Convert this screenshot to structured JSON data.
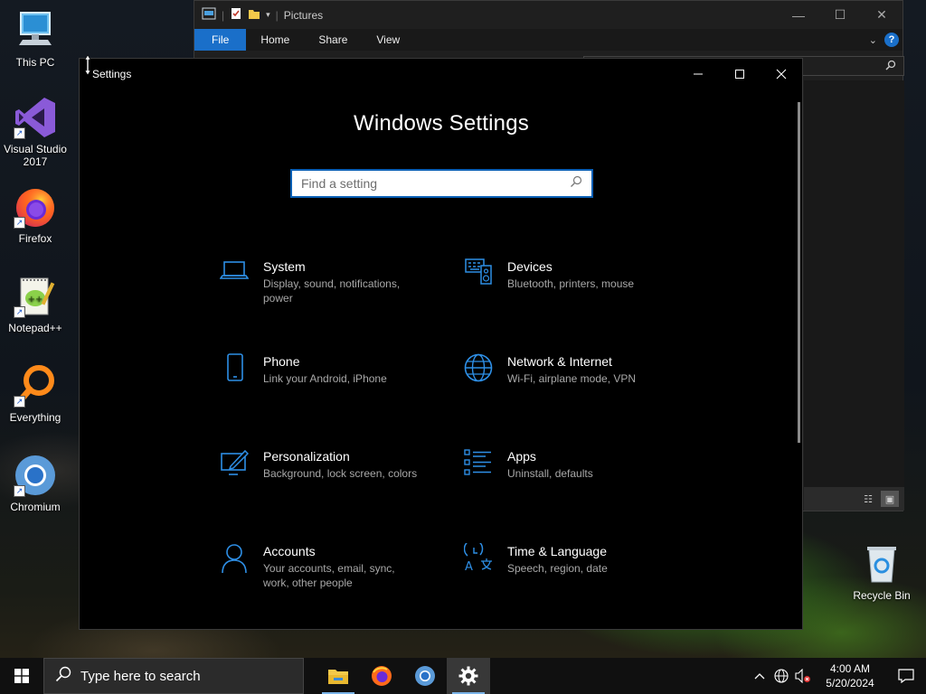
{
  "desktop": {
    "icons": [
      {
        "label": "This PC",
        "icon": "computer-icon"
      },
      {
        "label": "Visual Studio 2017",
        "icon": "visual-studio-icon"
      },
      {
        "label": "Firefox",
        "icon": "firefox-icon"
      },
      {
        "label": "Notepad++",
        "icon": "notepad-plus-plus-icon"
      },
      {
        "label": "Everything",
        "icon": "everything-search-icon"
      },
      {
        "label": "Chromium",
        "icon": "chromium-icon"
      }
    ],
    "recycle_bin": {
      "label": "Recycle Bin",
      "icon": "recycle-bin-icon"
    }
  },
  "explorer": {
    "title": "Pictures",
    "ribbon_tabs": [
      "File",
      "Home",
      "Share",
      "View"
    ],
    "help_label": "?"
  },
  "settings": {
    "window_title": "Settings",
    "heading": "Windows Settings",
    "search_placeholder": "Find a setting",
    "categories": [
      {
        "name": "System",
        "description": "Display, sound, notifications, power",
        "icon": "laptop-icon"
      },
      {
        "name": "Devices",
        "description": "Bluetooth, printers, mouse",
        "icon": "keyboard-speaker-icon"
      },
      {
        "name": "Phone",
        "description": "Link your Android, iPhone",
        "icon": "phone-icon"
      },
      {
        "name": "Network & Internet",
        "description": "Wi-Fi, airplane mode, VPN",
        "icon": "globe-icon"
      },
      {
        "name": "Personalization",
        "description": "Background, lock screen, colors",
        "icon": "paint-monitor-icon"
      },
      {
        "name": "Apps",
        "description": "Uninstall, defaults",
        "icon": "apps-list-icon"
      },
      {
        "name": "Accounts",
        "description": "Your accounts, email, sync, work, other people",
        "icon": "person-icon"
      },
      {
        "name": "Time & Language",
        "description": "Speech, region, date",
        "icon": "time-language-icon"
      }
    ]
  },
  "taskbar": {
    "search_placeholder": "Type here to search",
    "apps": [
      "file-explorer-icon",
      "firefox-icon",
      "chromium-icon",
      "settings-gear-icon"
    ],
    "clock": {
      "time": "4:00 AM",
      "date": "5/20/2024"
    }
  },
  "colors": {
    "accent": "#1a6fc9",
    "settings_icon_blue": "#2e8fe6",
    "window_bg": "#000000"
  }
}
